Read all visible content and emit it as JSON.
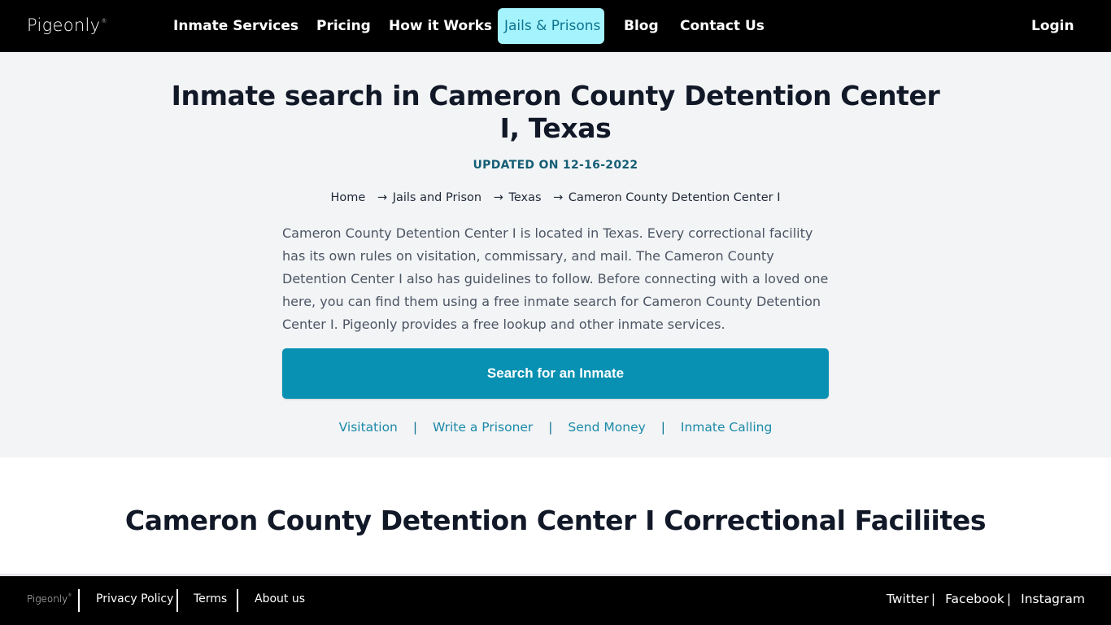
{
  "nav": {
    "logo": "Pigeonly",
    "logo_mark": "®",
    "items": [
      {
        "label": "Inmate Services"
      },
      {
        "label": "Pricing"
      },
      {
        "label": "How it Works"
      },
      {
        "label": "Jails & Prisons",
        "active": true
      },
      {
        "label": "Blog"
      },
      {
        "label": "Contact Us"
      }
    ],
    "login": "Login"
  },
  "hero": {
    "title": "Inmate search in Cameron County Detention Center I, Texas",
    "updated": "UPDATED ON 12-16-2022",
    "breadcrumb": [
      {
        "label": "Home"
      },
      {
        "label": "Jails and Prison"
      },
      {
        "label": "Texas"
      },
      {
        "label": "Cameron County Detention Center I"
      }
    ],
    "breadcrumb_separator": "→",
    "description": "Cameron County Detention Center I is located in Texas. Every correctional facility has its own rules on visitation, commissary, and mail. The Cameron County Detention Center I also has guidelines to follow. Before connecting with a loved one here, you can find them using a free inmate search for Cameron County Detention Center I. Pigeonly provides a free lookup and other inmate services.",
    "search_button": "Search for an Inmate",
    "service_links": [
      {
        "label": "Visitation"
      },
      {
        "label": "Write a Prisoner"
      },
      {
        "label": "Send Money"
      },
      {
        "label": "Inmate Calling"
      }
    ],
    "service_separator": "|"
  },
  "section": {
    "title": "Cameron County Detention Center I Correctional Faciliites"
  },
  "footer": {
    "logo": "Pigeonly",
    "logo_mark": "®",
    "links": [
      {
        "label": "Privacy Policy"
      },
      {
        "label": "Terms"
      },
      {
        "label": "About us"
      }
    ],
    "social": [
      {
        "label": "Twitter"
      },
      {
        "label": "Facebook"
      },
      {
        "label": "Instagram"
      }
    ],
    "social_separator": "|"
  },
  "colors": {
    "nav_bg": "#000000",
    "active_tab_bg": "#a5f3fc",
    "active_tab_text": "#0e7490",
    "hero_bg": "#f3f4f6",
    "accent": "#0891b2",
    "updated_text": "#155e75"
  }
}
